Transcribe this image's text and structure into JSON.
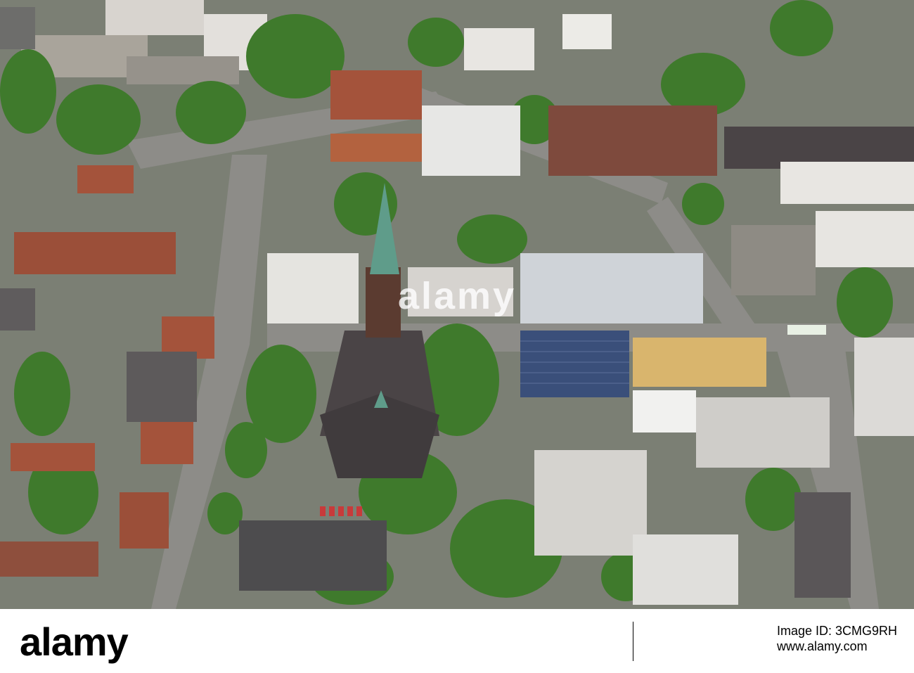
{
  "watermark": {
    "logo": "alamy"
  },
  "footer": {
    "logo": "alamy",
    "image_id_label": "Image ID: 3CMG9RH",
    "site": "www.alamy.com"
  },
  "colors": {
    "foliage": "#3f7a2c",
    "roof_dark": "#4a4446",
    "roof_red": "#a4533b",
    "street": "#8b8a86",
    "spire": "#5f9c8a",
    "solar": "#3a4f7a"
  }
}
